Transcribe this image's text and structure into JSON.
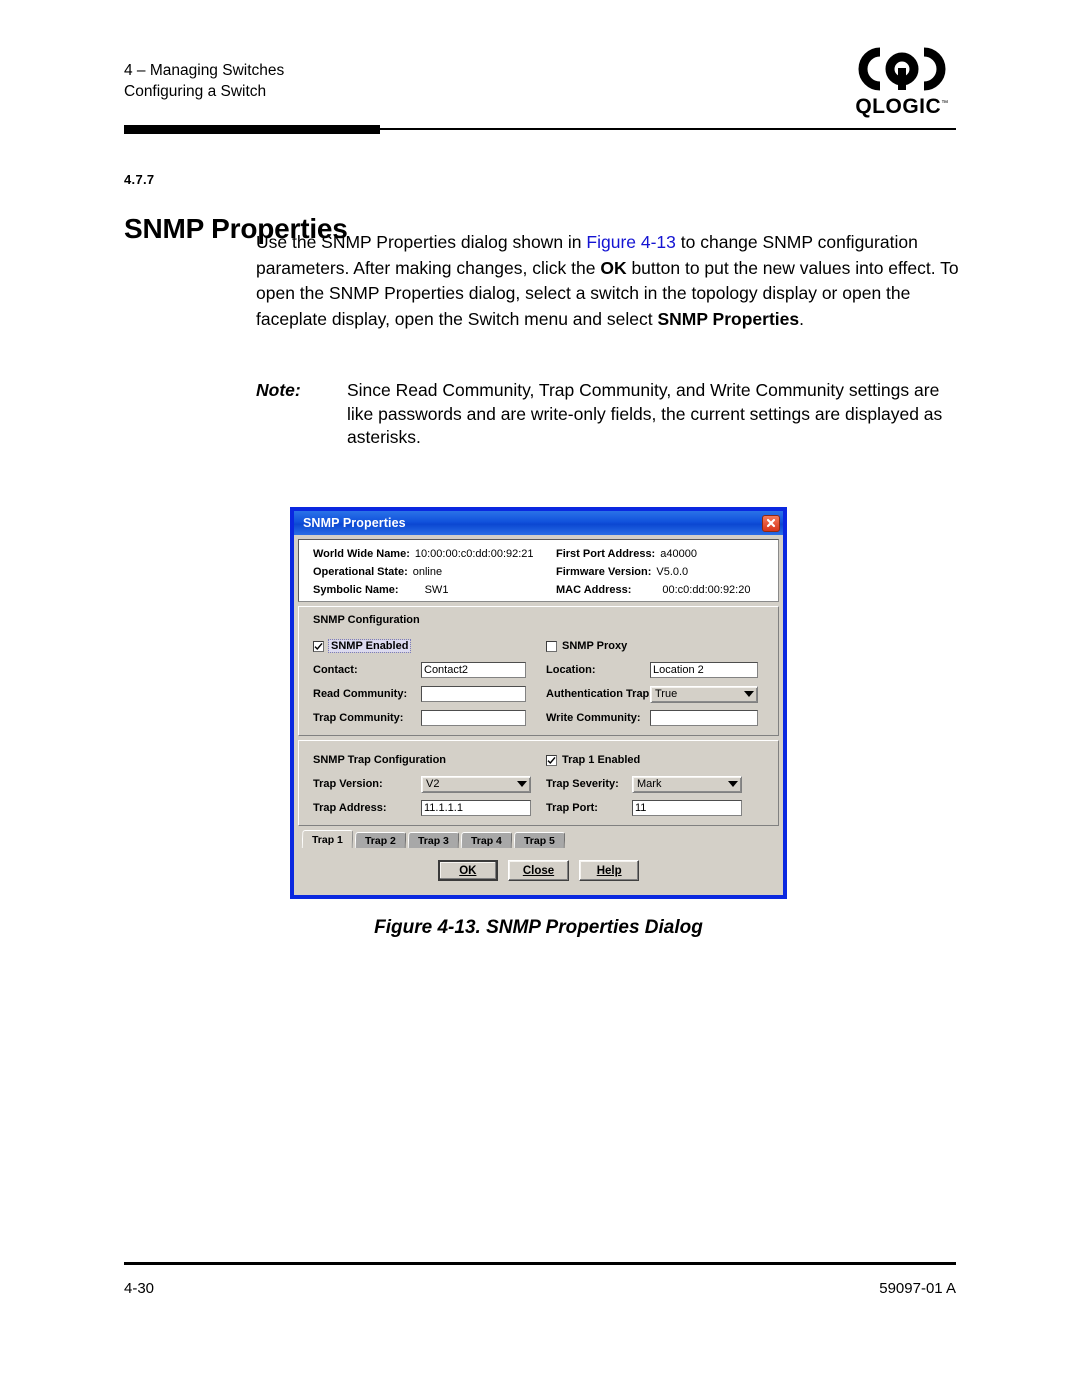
{
  "page": {
    "header": {
      "line1": "4 – Managing Switches",
      "line2": "Configuring a Switch",
      "logo_word": "QLOGIC",
      "logo_tm": "™"
    },
    "section": {
      "number": "4.7.7",
      "title": "SNMP Properties"
    },
    "body": {
      "p1_a": "Use the SNMP Properties dialog shown in ",
      "p1_figref": "Figure 4-13",
      "p1_b": " to change SNMP configuration parameters. After making changes, click the ",
      "p1_ok": "OK",
      "p1_c": " button to put the new values into effect. To open the SNMP Properties dialog, select a switch in the topology display or open the faceplate display, open the Switch menu and select ",
      "p1_bold_tail": "SNMP Properties",
      "p1_d": "."
    },
    "note": {
      "label": "Note:",
      "text": "Since Read Community, Trap Community, and Write Community settings are like passwords and are write-only fields, the current settings are displayed as asterisks."
    },
    "figure_caption": "Figure 4-13.  SNMP Properties Dialog",
    "footer": {
      "page_number": "4-30",
      "doc_number": "59097-01 A"
    }
  },
  "dialog": {
    "title": "SNMP Properties",
    "close_label": "×",
    "info": [
      {
        "label": "World Wide Name:",
        "value": "10:00:00:c0:dd:00:92:21",
        "label2": "First Port Address:",
        "value2": "a40000"
      },
      {
        "label": "Operational State:",
        "value": "online",
        "label2": "Firmware Version:",
        "value2": "V5.0.0"
      },
      {
        "label": "Symbolic Name:",
        "value": "SW1",
        "label2": "MAC Address:",
        "value2": "00:c0:dd:00:92:20"
      }
    ],
    "snmp_config": {
      "title": "SNMP Configuration",
      "snmp_enabled_label": "SNMP Enabled",
      "snmp_enabled_checked": true,
      "snmp_proxy_label": "SNMP Proxy",
      "snmp_proxy_checked": false,
      "contact_label": "Contact:",
      "contact_value": "Contact2",
      "location_label": "Location:",
      "location_value": "Location 2",
      "read_community_label": "Read Community:",
      "read_community_value": "",
      "auth_trap_label": "Authentication Trap:",
      "auth_trap_value": "True",
      "trap_community_label": "Trap Community:",
      "trap_community_value": "",
      "write_community_label": "Write Community:",
      "write_community_value": ""
    },
    "trap_config": {
      "title": "SNMP Trap Configuration",
      "trap_enabled_label": "Trap 1 Enabled",
      "trap_enabled_checked": true,
      "trap_version_label": "Trap Version:",
      "trap_version_value": "V2",
      "trap_severity_label": "Trap Severity:",
      "trap_severity_value": "Mark",
      "trap_address_label": "Trap Address:",
      "trap_address_value": "11.1.1.1",
      "trap_port_label": "Trap Port:",
      "trap_port_value": "11"
    },
    "tabs": [
      {
        "label": "Trap 1",
        "active": true
      },
      {
        "label": "Trap 2",
        "active": false
      },
      {
        "label": "Trap 3",
        "active": false
      },
      {
        "label": "Trap 4",
        "active": false
      },
      {
        "label": "Trap 5",
        "active": false
      }
    ],
    "buttons": {
      "ok": "OK",
      "close": "Close",
      "help": "Help"
    }
  },
  "colors": {
    "titlebar_blue": "#1152dc",
    "dialog_border": "#0a28e0",
    "dialog_face": "#d4d0c8",
    "close_red": "#d8341a",
    "link_blue": "#1414d2"
  }
}
